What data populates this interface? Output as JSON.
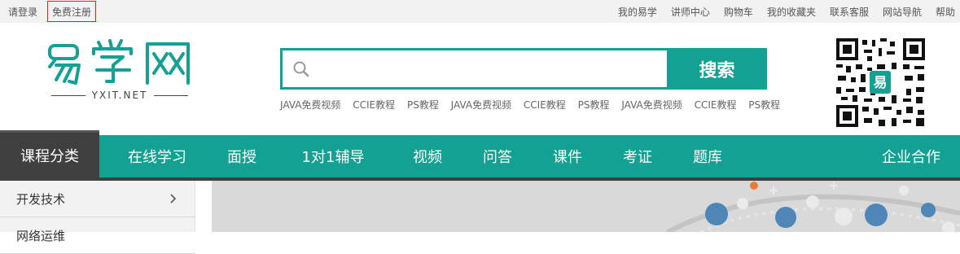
{
  "topbar": {
    "login": "请登录",
    "register": "免费注册",
    "links": [
      "我的易学",
      "讲师中心",
      "购物车",
      "我的收藏夹",
      "联系客服",
      "网站导航",
      "帮助"
    ]
  },
  "logo": {
    "text": "易学网",
    "site": "YXIT.NET"
  },
  "search": {
    "placeholder": "",
    "button": "搜索",
    "hotwords": [
      "JAVA免费视频",
      "CCIE教程",
      "PS教程",
      "JAVA免费视频",
      "CCIE教程",
      "PS教程",
      "JAVA免费视频",
      "CCIE教程",
      "PS教程"
    ]
  },
  "qr": {
    "label": "易"
  },
  "nav": {
    "category": "课程分类",
    "items": [
      "在线学习",
      "面授",
      "1对1辅导",
      "视频",
      "问答",
      "课件",
      "考证",
      "题库"
    ],
    "corp": "企业合作"
  },
  "sidebar": {
    "items": [
      {
        "label": "开发技术"
      },
      {
        "label": "网络运维"
      }
    ]
  },
  "colors": {
    "brand": "#12a192",
    "dark": "#3f3f3f",
    "register_border": "#e2231a"
  }
}
